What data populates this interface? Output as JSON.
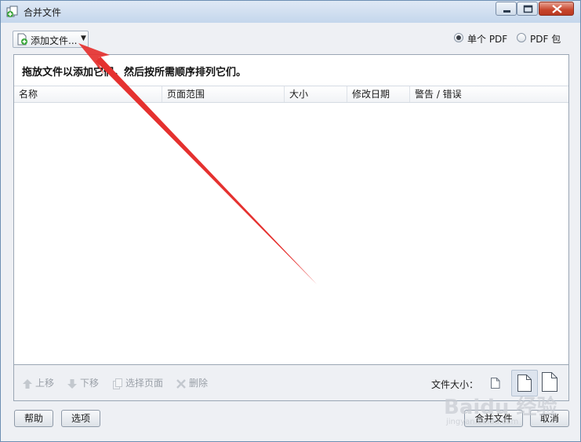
{
  "window": {
    "title": "合并文件"
  },
  "toolbar": {
    "add_files_label": "添加文件...",
    "output_options": [
      {
        "label": "单个 PDF",
        "selected": true
      },
      {
        "label": "PDF 包",
        "selected": false
      }
    ]
  },
  "panel": {
    "instruction": "拖放文件以添加它们，然后按所需顺序排列它们。",
    "columns": [
      "名称",
      "页面范围",
      "大小",
      "修改日期",
      "警告 / 错误"
    ],
    "rows": []
  },
  "bottom_toolbar": {
    "move_up_label": "上移",
    "move_down_label": "下移",
    "choose_pages_label": "选择页面",
    "delete_label": "删除",
    "file_size_label": "文件大小："
  },
  "footer": {
    "help_label": "帮助",
    "options_label": "选项",
    "combine_label": "合并文件",
    "cancel_label": "取消"
  },
  "watermark": {
    "text": "Baidu 经验",
    "sub": "jingyan.baidu.com"
  },
  "colors": {
    "annotation_arrow": "#e5312f",
    "title_bar": "#c4d6ec",
    "close_button": "#c7452c"
  },
  "icons": {
    "app": "combine-files-icon",
    "add_files": "add-file-icon",
    "move_up": "arrow-up-icon",
    "move_down": "arrow-down-icon",
    "choose_pages": "pages-icon",
    "delete": "x-icon",
    "file_size_options": [
      "small-page-icon",
      "medium-page-icon",
      "large-page-icon"
    ]
  }
}
